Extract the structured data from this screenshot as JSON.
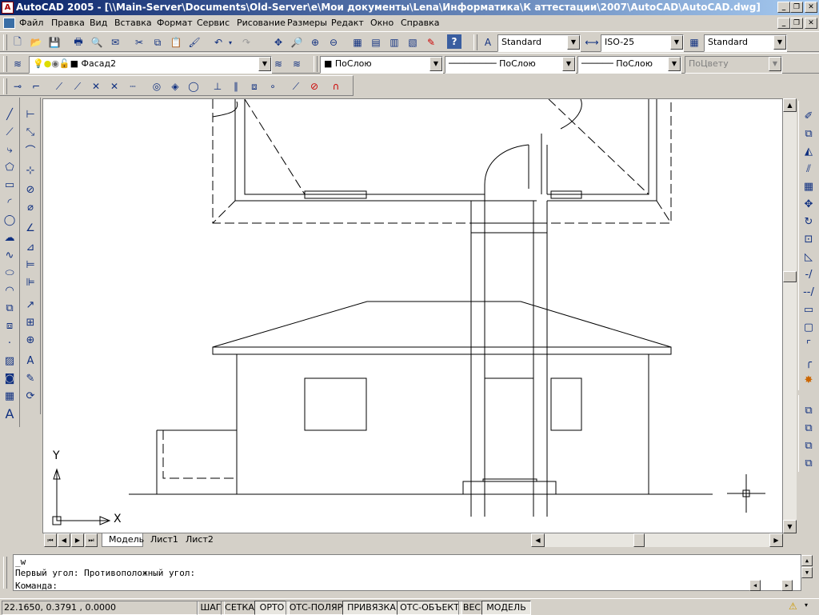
{
  "window": {
    "title": "AutoCAD 2005 - [\\\\Main-Server\\Documents\\Old-Server\\e\\Мои документы\\Lena\\Информатика\\К аттестации\\2007\\AutoCAD\\AutoCAD.dwg]",
    "app_icon": "A"
  },
  "menu": [
    "Файл",
    "Правка",
    "Вид",
    "Вставка",
    "Формат",
    "Сервис",
    "Рисование",
    "Размеры",
    "Редакт",
    "Окно",
    "Справка"
  ],
  "styles_toolbar": {
    "text_style": "Standard",
    "dim_style": "ISO-25",
    "table_style": "Standard"
  },
  "layers_toolbar": {
    "layer": "Фасад2",
    "color": "ПоСлою",
    "linetype": "ПоСлою",
    "lineweight": "ПоСлою",
    "plotstyle": "ПоЦвету"
  },
  "ucs": {
    "y_label": "Y",
    "x_label": "X"
  },
  "tabs": [
    "Модель",
    "Лист1",
    "Лист2"
  ],
  "command": {
    "lines": [
      "_w",
      "Первый угол: Противоположный угол:"
    ],
    "prompt": "Команда:"
  },
  "status": {
    "coords": "22.1650, 0.3791 , 0.0000",
    "toggles": [
      {
        "label": "ШАГ",
        "on": false
      },
      {
        "label": "СЕТКА",
        "on": false
      },
      {
        "label": "ОРТО",
        "on": true
      },
      {
        "label": "ОТС-ПОЛЯР",
        "on": false
      },
      {
        "label": "ПРИВЯЗКА",
        "on": true
      },
      {
        "label": "ОТС-ОБЪЕКТ",
        "on": true
      },
      {
        "label": "ВЕС",
        "on": false
      },
      {
        "label": "МОДЕЛЬ",
        "on": true
      }
    ]
  },
  "colors": {
    "title_start": "#0a246a",
    "title_end": "#a6caf0",
    "chrome": "#d4d0c8",
    "canvas": "#ffffff"
  }
}
